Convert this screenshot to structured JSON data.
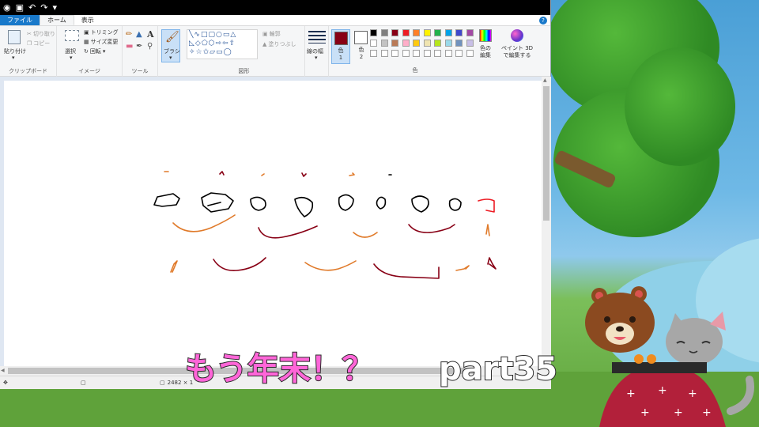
{
  "app": {
    "quick_access": [
      "save-icon",
      "undo-icon",
      "redo-icon"
    ]
  },
  "tabs": [
    {
      "label": "ファイル",
      "active": false
    },
    {
      "label": "ホーム",
      "active": true
    },
    {
      "label": "表示",
      "active": false
    }
  ],
  "help_label": "?",
  "ribbon": {
    "clipboard": {
      "paste": "貼り付け",
      "cut": "切り取り",
      "copy": "コピー",
      "group": "クリップボード"
    },
    "image": {
      "select": "選択",
      "crop": "トリミング",
      "resize": "サイズ変更",
      "rotate": "回転",
      "group": "イメージ"
    },
    "tools": {
      "group": "ツール",
      "brush": "ブラシ"
    },
    "shapes": {
      "outline": "輪郭",
      "fill": "塗りつぶし",
      "group": "図形"
    },
    "size": {
      "label": "線の幅"
    },
    "colors": {
      "color1": "色",
      "color1_num": "1",
      "color2": "色",
      "color2_num": "2",
      "edit": "色の\n編集",
      "group": "色",
      "palette_row1": [
        "#000000",
        "#7f7f7f",
        "#880015",
        "#ed1c24",
        "#ff7f27",
        "#fff200",
        "#22b14c",
        "#00a2e8",
        "#3f48cc",
        "#a349a4"
      ],
      "palette_row2": [
        "#ffffff",
        "#c3c3c3",
        "#b97a57",
        "#ffaec9",
        "#ffc90e",
        "#efe4b0",
        "#b5e61d",
        "#99d9ea",
        "#7092be",
        "#c8bfe7"
      ],
      "color1_value": "#880015",
      "color2_value": "#ffffff"
    },
    "paint3d": {
      "label": "ペイント 3D\nで編集する"
    }
  },
  "status": {
    "dimensions": "2482 × 1"
  },
  "caption": {
    "main": "もう年末！？",
    "part": "part35"
  }
}
